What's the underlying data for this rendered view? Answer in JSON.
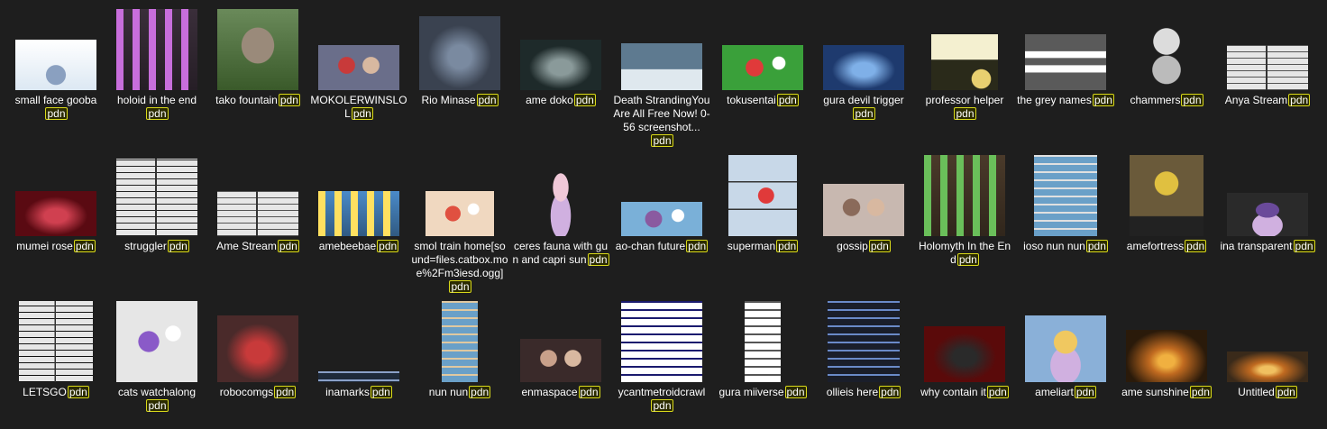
{
  "badge_label": "pdn",
  "rows": [
    [
      {
        "name": "small face gooba",
        "w": 90,
        "h": 56,
        "bg": "#dce8f3",
        "fg": "#8aa0c0",
        "art": "face"
      },
      {
        "name": "holoid in the end",
        "w": 90,
        "h": 90,
        "bg": "#3a2e3a",
        "fg": "#c86edc",
        "art": "blocks"
      },
      {
        "name": "tako fountain",
        "w": 90,
        "h": 90,
        "bg": "#4f6e3a",
        "fg": "#9a8a7a",
        "art": "fountain"
      },
      {
        "name": "MOKOLERWINSLOL",
        "w": 90,
        "h": 50,
        "bg": "#6a6e8a",
        "fg": "#c83a3a",
        "art": "people"
      },
      {
        "name": "Rio Minase",
        "w": 90,
        "h": 82,
        "bg": "#3a4250",
        "fg": "#7a8aa0",
        "art": "dark"
      },
      {
        "name": "ame doko",
        "w": 90,
        "h": 56,
        "bg": "#1e2a2a",
        "fg": "#8a9a9a",
        "art": "dark"
      },
      {
        "name": "Death StrandingYou Are All Free Now! 0-56 screenshot...",
        "w": 90,
        "h": 52,
        "bg": "#5e7a90",
        "fg": "#dfe8ee",
        "art": "snow"
      },
      {
        "name": "tokusentai",
        "w": 90,
        "h": 50,
        "bg": "#3aa03a",
        "fg": "#e03a3a",
        "art": "cartoon"
      },
      {
        "name": "gura devil trigger",
        "w": 90,
        "h": 50,
        "bg": "#1e3a6e",
        "fg": "#7fb0e8",
        "art": "dark"
      },
      {
        "name": "professor helper",
        "w": 74,
        "h": 62,
        "bg": "#2a2a1a",
        "fg": "#e8d070",
        "art": "dialog"
      },
      {
        "name": "the grey names",
        "w": 90,
        "h": 62,
        "bg": "#5a5a5a",
        "fg": "#ffffff",
        "art": "title"
      },
      {
        "name": "chammers",
        "w": 74,
        "h": 90,
        "bg": "#1e1e1e",
        "fg": "#dcdcdc",
        "art": "sketch"
      },
      {
        "name": "Anya Stream",
        "w": 90,
        "h": 50,
        "bg": "#e6e6e6",
        "fg": "#555555",
        "art": "manga"
      }
    ],
    [
      {
        "name": "mumei rose",
        "w": 90,
        "h": 50,
        "bg": "#5a0a12",
        "fg": "#d04050",
        "art": "dark"
      },
      {
        "name": "struggler",
        "w": 90,
        "h": 86,
        "bg": "#e6e6e6",
        "fg": "#222222",
        "art": "manga"
      },
      {
        "name": "Ame Stream",
        "w": 90,
        "h": 50,
        "bg": "#e6e6e6",
        "fg": "#555555",
        "art": "manga"
      },
      {
        "name": "amebeebae",
        "w": 90,
        "h": 50,
        "bg": "#4a8ac8",
        "fg": "#ffe060",
        "art": "blocks"
      },
      {
        "name": "smol train home[sound=files.catbox.moe%2Fm3iesd.ogg]",
        "w": 76,
        "h": 50,
        "bg": "#f0d8c0",
        "fg": "#e05040",
        "art": "cartoon"
      },
      {
        "name": "ceres fauna with gun and capri sun",
        "w": 60,
        "h": 90,
        "bg": "#1e1e1e",
        "fg": "#f0c8d8",
        "art": "figure"
      },
      {
        "name": "ao-chan future",
        "w": 90,
        "h": 38,
        "bg": "#7ab0d8",
        "fg": "#8a5aa0",
        "art": "cartoon"
      },
      {
        "name": "superman",
        "w": 76,
        "h": 90,
        "bg": "#c8d8e8",
        "fg": "#e03a3a",
        "art": "comic"
      },
      {
        "name": "gossip",
        "w": 90,
        "h": 58,
        "bg": "#c8b8b0",
        "fg": "#8a6a5a",
        "art": "people"
      },
      {
        "name": "Holomyth In the End",
        "w": 90,
        "h": 90,
        "bg": "#4a3a2a",
        "fg": "#6abf5a",
        "art": "blocks"
      },
      {
        "name": "ioso nun nun",
        "w": 70,
        "h": 90,
        "bg": "#6aa0c8",
        "fg": "#e0e0e0",
        "art": "tweet"
      },
      {
        "name": "amefortress",
        "w": 82,
        "h": 90,
        "bg": "#6a5a3a",
        "fg": "#e0c040",
        "art": "poster"
      },
      {
        "name": "ina transparent",
        "w": 90,
        "h": 48,
        "bg": "#2a2a2a",
        "fg": "#6a4a9a",
        "art": "figure"
      }
    ],
    [
      {
        "name": "LETSGO",
        "w": 82,
        "h": 90,
        "bg": "#e6e6e6",
        "fg": "#111111",
        "art": "manga"
      },
      {
        "name": "cats watchalong",
        "w": 90,
        "h": 90,
        "bg": "#e6e6e6",
        "fg": "#8a5ac8",
        "art": "cartoon"
      },
      {
        "name": "robocomgs",
        "w": 90,
        "h": 74,
        "bg": "#4a2a2a",
        "fg": "#c83a3a",
        "art": "dark"
      },
      {
        "name": "inamarks",
        "w": 90,
        "h": 12,
        "bg": "#1e2a3a",
        "fg": "#8aa0c8",
        "art": "tweet"
      },
      {
        "name": "nun nun",
        "w": 40,
        "h": 90,
        "bg": "#6aa0c8",
        "fg": "#e0c8a0",
        "art": "tweet"
      },
      {
        "name": "enmaspace",
        "w": 90,
        "h": 48,
        "bg": "#3a2a2a",
        "fg": "#c8a08a",
        "art": "people"
      },
      {
        "name": "ycantmetroidcrawl",
        "w": 90,
        "h": 90,
        "bg": "#ffffff",
        "fg": "#1a1a6e",
        "art": "tweet"
      },
      {
        "name": "gura miiverse",
        "w": 40,
        "h": 90,
        "bg": "#ffffff",
        "fg": "#555555",
        "art": "tweet"
      },
      {
        "name": "ollieis here",
        "w": 80,
        "h": 90,
        "bg": "#1a1e2a",
        "fg": "#6a8ac8",
        "art": "tweet"
      },
      {
        "name": "why contain it",
        "w": 90,
        "h": 62,
        "bg": "#5a0a0a",
        "fg": "#2a2a2a",
        "art": "dark"
      },
      {
        "name": "ameliart",
        "w": 90,
        "h": 74,
        "bg": "#8ab0d8",
        "fg": "#f0c860",
        "art": "figure"
      },
      {
        "name": "ame sunshine",
        "w": 90,
        "h": 58,
        "bg": "#2a1a0a",
        "fg": "#f0b040",
        "art": "sun"
      },
      {
        "name": "Untitled",
        "w": 90,
        "h": 34,
        "bg": "#3a2a1a",
        "fg": "#f0c060",
        "art": "sun"
      }
    ]
  ]
}
